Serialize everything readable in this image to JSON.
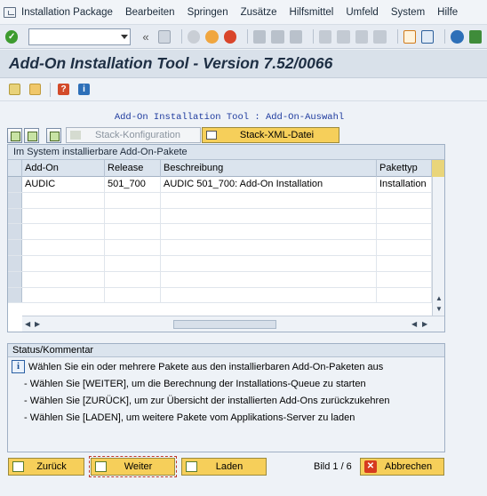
{
  "menu": [
    "Installation Package",
    "Bearbeiten",
    "Springen",
    "Zusätze",
    "Hilfsmittel",
    "Umfeld",
    "System",
    "Hilfe"
  ],
  "toolbar": {
    "command_value": "",
    "nav_glyph": "«"
  },
  "title": "Add-On Installation Tool - Version 7.52/0066",
  "screen_title": "Add-On Installation Tool : Add-On-Auswahl",
  "stack_buttons": {
    "konfig": "Stack-Konfiguration",
    "xml": "Stack-XML-Datei"
  },
  "table": {
    "title": "Im System installierbare Add-On-Pakete",
    "headers": [
      "Add-On",
      "Release",
      "Beschreibung",
      "Pakettyp"
    ],
    "rows": [
      [
        "AUDIC",
        "501_700",
        "AUDIC 501_700: Add-On Installation",
        "Installation"
      ]
    ]
  },
  "status": {
    "title": "Status/Kommentar",
    "info": "Wählen Sie ein oder mehrere Pakete aus den installierbaren Add-On-Paketen aus",
    "lines": [
      "- Wählen Sie [WEITER], um die Berechnung der Installations-Queue zu starten",
      "- Wählen Sie [ZURÜCK], um zur Übersicht der installierten Add-Ons zurückzukehren",
      "- Wählen Sie [LADEN], um weitere Pakete vom Applikations-Server zu laden"
    ]
  },
  "footer": {
    "back": "Zurück",
    "next": "Weiter",
    "load": "Laden",
    "page": "Bild 1 / 6",
    "cancel": "Abbrechen"
  },
  "colors": {
    "accent": "#f6cf5a",
    "title": "#1e2f44",
    "screen_title": "#1d3a9e"
  }
}
